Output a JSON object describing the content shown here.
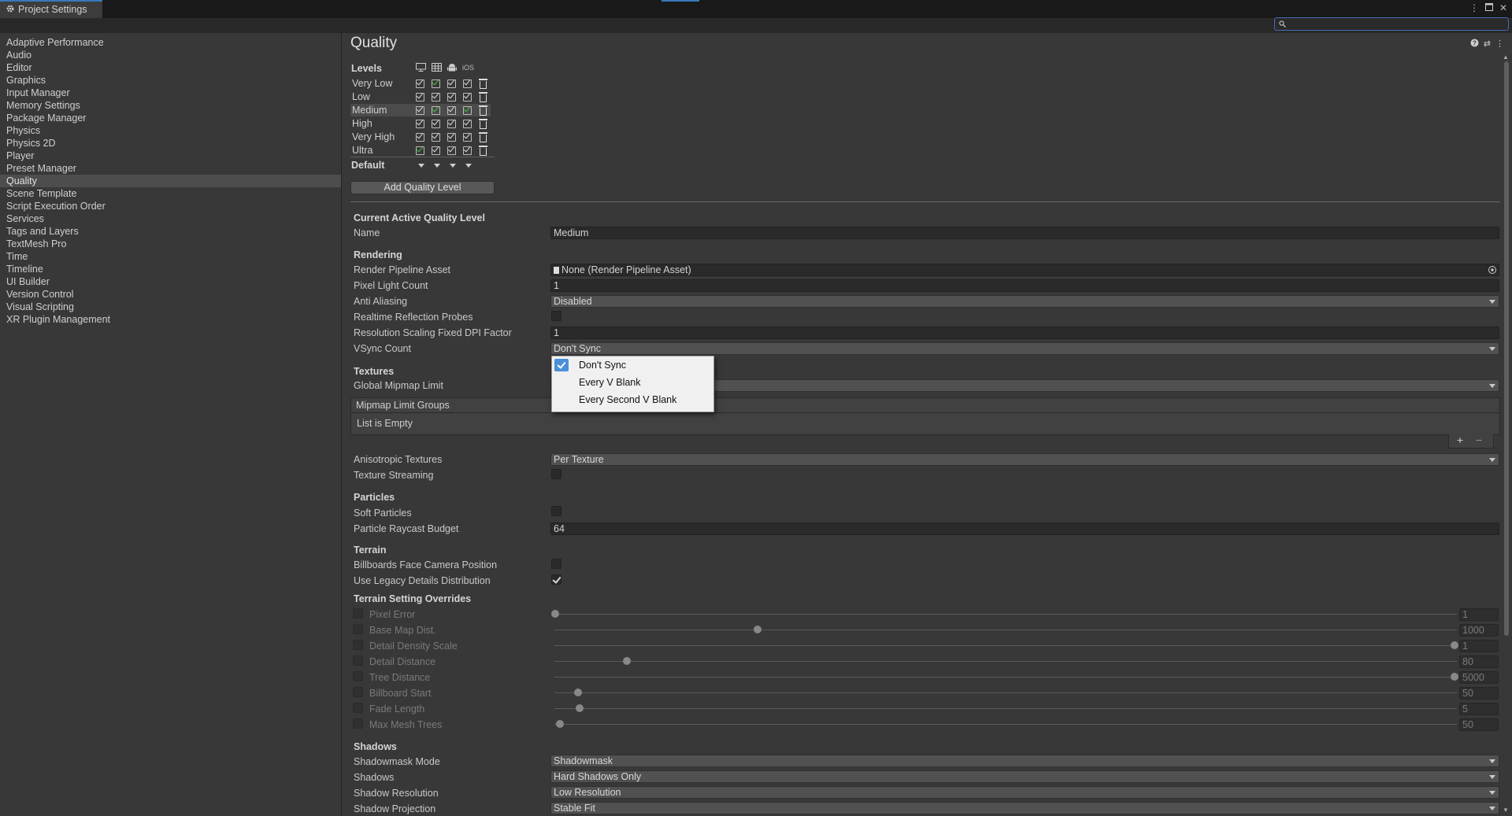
{
  "window": {
    "tab_title": "Project Settings",
    "search_placeholder": ""
  },
  "sidebar": {
    "items": [
      "Adaptive Performance",
      "Audio",
      "Editor",
      "Graphics",
      "Input Manager",
      "Memory Settings",
      "Package Manager",
      "Physics",
      "Physics 2D",
      "Player",
      "Preset Manager",
      "Quality",
      "Scene Template",
      "Script Execution Order",
      "Services",
      "Tags and Layers",
      "TextMesh Pro",
      "Time",
      "Timeline",
      "UI Builder",
      "Version Control",
      "Visual Scripting",
      "XR Plugin Management"
    ],
    "selected": "Quality"
  },
  "page": {
    "title": "Quality"
  },
  "levels": {
    "label": "Levels",
    "platform_ios": "iOS",
    "rows": [
      {
        "name": "Very Low",
        "sel": false
      },
      {
        "name": "Low",
        "sel": false
      },
      {
        "name": "Medium",
        "sel": true
      },
      {
        "name": "High",
        "sel": false
      },
      {
        "name": "Very High",
        "sel": false
      },
      {
        "name": "Ultra",
        "sel": false
      }
    ],
    "default_label": "Default",
    "add_button": "Add Quality Level"
  },
  "current": {
    "section": "Current Active Quality Level",
    "name_label": "Name",
    "name_value": "Medium"
  },
  "rendering": {
    "header": "Rendering",
    "pipeline_label": "Render Pipeline Asset",
    "pipeline_value": "None (Render Pipeline Asset)",
    "pixel_light_label": "Pixel Light Count",
    "pixel_light_value": "1",
    "aa_label": "Anti Aliasing",
    "aa_value": "Disabled",
    "reflection_label": "Realtime Reflection Probes",
    "dpi_label": "Resolution Scaling Fixed DPI Factor",
    "dpi_value": "1",
    "vsync_label": "VSync Count",
    "vsync_value": "Don't Sync"
  },
  "vsync_popup": {
    "options": [
      "Don't Sync",
      "Every V Blank",
      "Every Second V Blank"
    ],
    "selected": "Don't Sync"
  },
  "textures": {
    "header": "Textures",
    "mipmap_label": "Global Mipmap Limit",
    "groups_label": "Mipmap Limit Groups",
    "groups_empty": "List is Empty",
    "plus": "+",
    "minus": "−",
    "aniso_label": "Anisotropic Textures",
    "aniso_value": "Per Texture",
    "streaming_label": "Texture Streaming"
  },
  "particles": {
    "header": "Particles",
    "soft_label": "Soft Particles",
    "raycast_label": "Particle Raycast Budget",
    "raycast_value": "64"
  },
  "terrain": {
    "header": "Terrain",
    "billboards_label": "Billboards Face Camera Position",
    "legacy_label": "Use Legacy Details Distribution"
  },
  "terrain_overrides": {
    "header": "Terrain Setting Overrides",
    "rows": [
      {
        "label": "Pixel Error",
        "value": "1",
        "level": 0.0
      },
      {
        "label": "Base Map Dist.",
        "value": "1000",
        "level": 0.225
      },
      {
        "label": "Detail Density Scale",
        "value": "1",
        "level": 1.0
      },
      {
        "label": "Detail Distance",
        "value": "80",
        "level": 0.08
      },
      {
        "label": "Tree Distance",
        "value": "5000",
        "level": 1.0
      },
      {
        "label": "Billboard Start",
        "value": "50",
        "level": 0.025
      },
      {
        "label": "Fade Length",
        "value": "5",
        "level": 0.027
      },
      {
        "label": "Max Mesh Trees",
        "value": "50",
        "level": 0.005
      }
    ]
  },
  "shadows": {
    "header": "Shadows",
    "mask_label": "Shadowmask Mode",
    "mask_value": "Shadowmask",
    "shadows_label": "Shadows",
    "shadows_value": "Hard Shadows Only",
    "res_label": "Shadow Resolution",
    "res_value": "Low Resolution",
    "proj_label": "Shadow Projection",
    "proj_value": "Stable Fit"
  },
  "colors": {
    "accent": "#3a79bb",
    "green_check": "#3ec43e",
    "bg": "#383838"
  }
}
